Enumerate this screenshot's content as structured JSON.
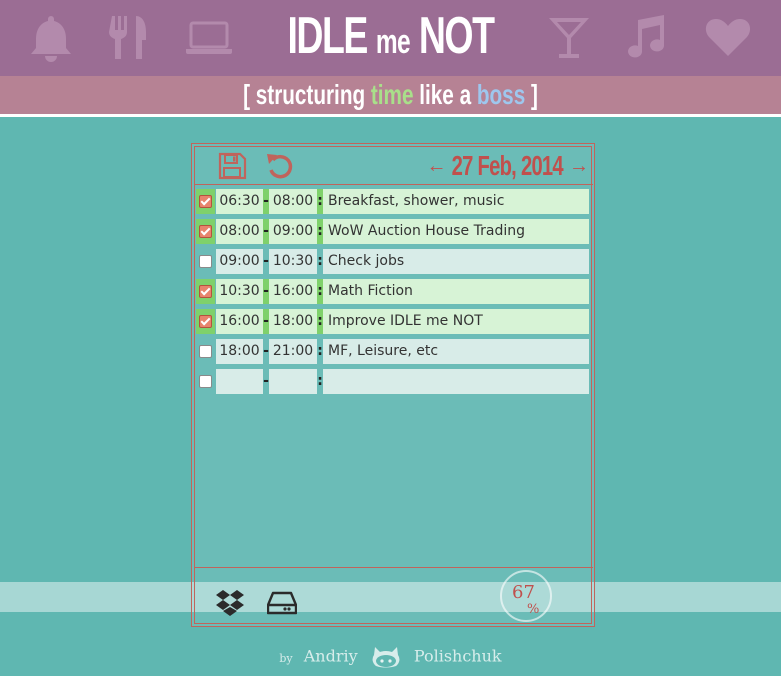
{
  "app": {
    "title_part1": "IDLE",
    "title_part2": "me",
    "title_part3": "NOT",
    "subtitle_open": "[ structuring",
    "subtitle_word1": "time",
    "subtitle_mid": "like a",
    "subtitle_word2": "boss",
    "subtitle_close": "]"
  },
  "header_icons": [
    "bell-icon",
    "fork-knife-icon",
    "laptop-icon",
    "cocktail-icon",
    "music-note-icon",
    "heart-icon"
  ],
  "toolbar": {
    "save_icon": "floppy-disk-icon",
    "reset_icon": "undo-icon",
    "prev_arrow": "←",
    "date": "27 Feb, 2014",
    "next_arrow": "→"
  },
  "schedule": [
    {
      "done": true,
      "start": "06:30",
      "end": "08:00",
      "task": "Breakfast, shower, music"
    },
    {
      "done": true,
      "start": "08:00",
      "end": "09:00",
      "task": "WoW Auction House Trading"
    },
    {
      "done": false,
      "start": "09:00",
      "end": "10:30",
      "task": "Check jobs"
    },
    {
      "done": true,
      "start": "10:30",
      "end": "16:00",
      "task": "Math Fiction"
    },
    {
      "done": true,
      "start": "16:00",
      "end": "18:00",
      "task": "Improve IDLE me NOT"
    },
    {
      "done": false,
      "start": "18:00",
      "end": "21:00",
      "task": "MF, Leisure, etc"
    },
    {
      "done": false,
      "start": "",
      "end": "",
      "task": ""
    }
  ],
  "separators": {
    "dash": "-",
    "colon": ":"
  },
  "footer": {
    "dropbox_icon": "dropbox-icon",
    "drive_icon": "hard-drive-icon",
    "progress_value": "67",
    "progress_unit": "%"
  },
  "byline": {
    "by": "by",
    "first": "Andriy",
    "last": "Polishchuk",
    "icon": "github-octocat-icon"
  },
  "colors": {
    "header": "#9b6d94",
    "subtitle_bar": "#b68294",
    "background": "#5fb7b1",
    "accent_red": "#c0504d",
    "done_green": "#7fd16b",
    "word_time": "#a9e08a",
    "word_boss": "#9ec7ee"
  }
}
